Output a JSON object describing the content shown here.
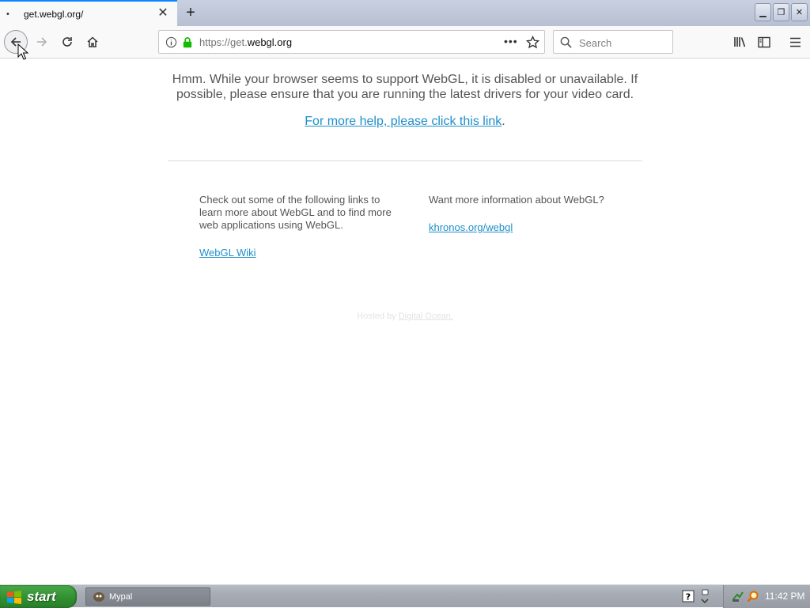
{
  "browser": {
    "tab": {
      "title": "get.webgl.org/",
      "favicon": "•",
      "close_glyph": "✕"
    },
    "new_tab_glyph": "+",
    "window_controls": {
      "minimize": "▁",
      "maximize": "❐",
      "close": "✕"
    },
    "toolbar": {
      "back_icon": "back-arrow-icon",
      "forward_icon": "forward-arrow-icon",
      "reload_icon": "reload-icon",
      "home_icon": "home-icon"
    },
    "urlbar": {
      "scheme_prefix": "https://get.",
      "domain": "webgl.org",
      "more_glyph": "•••"
    },
    "searchbar": {
      "placeholder": "Search"
    }
  },
  "page": {
    "message": "Hmm. While your browser seems to support WebGL, it is disabled or unavailable. If possible, please ensure that you are running the latest drivers for your video card.",
    "help_link": "For more help, please click this link",
    "help_suffix": ".",
    "left_column": {
      "text": "Check out some of the following links to learn more about WebGL and to find more web applications using WebGL.",
      "link": "WebGL Wiki"
    },
    "right_column": {
      "text": "Want more information about WebGL?",
      "link": "khronos.org/webgl"
    },
    "hosted_prefix": "Hosted by ",
    "hosted_link": "Digital Ocean."
  },
  "taskbar": {
    "start_label": "start",
    "tasks": [
      {
        "label": "Mypal"
      }
    ],
    "clock": "11:42 PM"
  },
  "colors": {
    "link": "#1f8fc9",
    "tab_accent": "#0a84ff",
    "start_green": "#2f8f2f",
    "lock_green": "#12bc00"
  }
}
